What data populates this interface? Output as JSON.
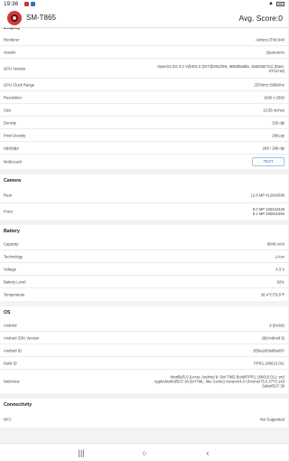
{
  "status_bar": {
    "time": "19:36",
    "icons_right": "▲ ▮"
  },
  "header": {
    "app_title": "SM-T865",
    "score": "Avg. Score:0"
  },
  "display": {
    "title": "Display",
    "rows": [
      {
        "label": "Renderer",
        "value": "Adreno (TM) 640"
      },
      {
        "label": "Vendor",
        "value": "Qualcomm"
      },
      {
        "label": "GPU Version",
        "value": "OpenGL ES 3.2 V@401.0 (GIT@0912fe6, I855d9a5b5, 1562832711) (Date:\n07/11/19)"
      },
      {
        "label": "GPU Clock Range",
        "value": "257MHz~585MHz"
      },
      {
        "label": "Resolution",
        "value": "1600 x 2560"
      },
      {
        "label": "Size",
        "value": "10.55 inches"
      },
      {
        "label": "Density",
        "value": "320 dpi"
      },
      {
        "label": "Pixel Density",
        "value": "286 ppi"
      },
      {
        "label": "xdpi/ydpi",
        "value": "286 / 286 dpi"
      },
      {
        "label": "Multi-touch",
        "button": "TEST"
      }
    ]
  },
  "camera": {
    "title": "Camera",
    "rows": [
      {
        "label": "Rear",
        "value": "12.8 MP 4128x3096"
      },
      {
        "label": "Front",
        "value": "8.0 MP 3264x2448\n5.1 MP 2608x1956"
      }
    ]
  },
  "battery": {
    "title": "Battery",
    "rows": [
      {
        "label": "Capacity",
        "value": "6840 mAh"
      },
      {
        "label": "Technology",
        "value": "Li-ion"
      },
      {
        "label": "Voltage",
        "value": "4.3 V"
      },
      {
        "label": "Battery Level",
        "value": "82%"
      },
      {
        "label": "Temperature",
        "value": "26.4℃/79.5℉"
      }
    ]
  },
  "os": {
    "title": "OS",
    "rows": [
      {
        "label": "Android",
        "value": "9 (64-bit)"
      },
      {
        "label": "Android SDK Version",
        "value": "28(Android 9)"
      },
      {
        "label": "Android ID",
        "value": "2f59a2609d6bef87"
      },
      {
        "label": "Build ID",
        "value": "PPR1.180610.011"
      },
      {
        "label": "WebView",
        "value": "Mozilla/5.0 (Linux; Android 9; SM-T865 Build/PPR1.180610.011; wv)\nAppleWebKit/537.36 (KHTML, like Gecko) Version/4.0 Chrome/75.0.3770.143\nSafari/537.36"
      }
    ]
  },
  "connectivity": {
    "title": "Connectivity",
    "rows": [
      {
        "label": "NFC",
        "value": "Not Supported"
      }
    ]
  },
  "nav": {
    "recents": "|||",
    "home": "○",
    "back": "‹"
  }
}
